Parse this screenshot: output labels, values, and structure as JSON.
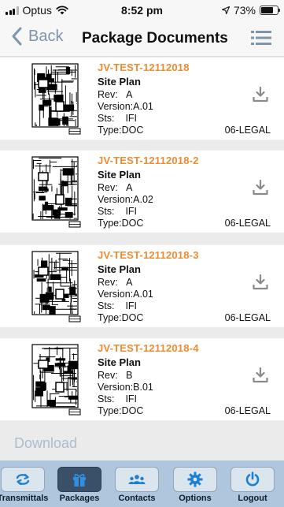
{
  "status_bar": {
    "carrier": "Optus",
    "time": "8:52 pm",
    "battery": "73%",
    "battery_level": 0.73
  },
  "nav": {
    "back_label": "Back",
    "title": "Package Documents"
  },
  "documents": [
    {
      "number": "JV-TEST-12112018",
      "title": "Site Plan",
      "rev_label": "Rev:",
      "rev": "A",
      "version_label": "Version:",
      "version": "A.01",
      "sts_label": "Sts:",
      "sts": "IFI",
      "type_label": "Type:",
      "type": "DOC",
      "size": "06-LEGAL"
    },
    {
      "number": "JV-TEST-12112018-2",
      "title": "Site Plan",
      "rev_label": "Rev:",
      "rev": "A",
      "version_label": "Version:",
      "version": "A.02",
      "sts_label": "Sts:",
      "sts": "IFI",
      "type_label": "Type:",
      "type": "DOC",
      "size": "06-LEGAL"
    },
    {
      "number": "JV-TEST-12112018-3",
      "title": "Site Plan",
      "rev_label": "Rev:",
      "rev": "A",
      "version_label": "Version:",
      "version": "A.01",
      "sts_label": "Sts:",
      "sts": "IFI",
      "type_label": "Type:",
      "type": "DOC",
      "size": "06-LEGAL"
    },
    {
      "number": "JV-TEST-12112018-4",
      "title": "Site Plan",
      "rev_label": "Rev:",
      "rev": "B",
      "version_label": "Version:",
      "version": "B.01",
      "sts_label": "Sts:",
      "sts": "IFI",
      "type_label": "Type:",
      "type": "DOC",
      "size": "06-LEGAL"
    }
  ],
  "download_label": "Download",
  "tabs": [
    {
      "label": "Transmittals",
      "icon": "sync-icon",
      "active": false
    },
    {
      "label": "Packages",
      "icon": "gift-icon",
      "active": true
    },
    {
      "label": "Contacts",
      "icon": "people-icon",
      "active": false
    },
    {
      "label": "Options",
      "icon": "gear-icon",
      "active": false
    },
    {
      "label": "Logout",
      "icon": "power-icon",
      "active": false
    }
  ],
  "colors": {
    "accent_orange": "#f28a30",
    "nav_blue": "#7d94aa",
    "tab_bar": "#afc6dc",
    "tab_active": "#3a5068",
    "download_disabled": "#a9bed0"
  }
}
